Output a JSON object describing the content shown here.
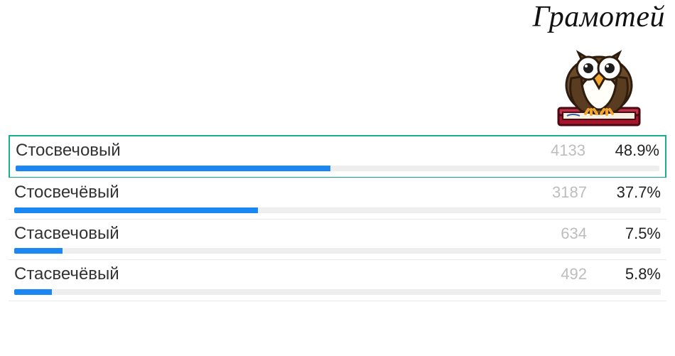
{
  "brand": {
    "title": "Грамотей"
  },
  "options": [
    {
      "label": "Стосвечовый",
      "count": "4133",
      "pct_label": "48.9%",
      "pct": 48.9,
      "correct": true
    },
    {
      "label": "Стосвечёвый",
      "count": "3187",
      "pct_label": "37.7%",
      "pct": 37.7,
      "correct": false
    },
    {
      "label": "Стасвечовый",
      "count": "634",
      "pct_label": "7.5%",
      "pct": 7.5,
      "correct": false
    },
    {
      "label": "Стасвечёвый",
      "count": "492",
      "pct_label": "5.8%",
      "pct": 5.8,
      "correct": false
    }
  ],
  "colors": {
    "bar_fill": "#1b87f3",
    "bar_bg": "#eeeeee",
    "correct_border": "#1aae8f",
    "count_text": "#bdbdbd"
  },
  "chart_data": {
    "type": "bar",
    "title": "",
    "xlabel": "",
    "ylabel": "",
    "categories": [
      "Стосвечовый",
      "Стосвечёвый",
      "Стасвечовый",
      "Стасвечёвый"
    ],
    "series": [
      {
        "name": "count",
        "values": [
          4133,
          3187,
          634,
          492
        ]
      },
      {
        "name": "percent",
        "values": [
          48.9,
          37.7,
          7.5,
          5.8
        ]
      }
    ],
    "ylim": [
      0,
      100
    ]
  }
}
